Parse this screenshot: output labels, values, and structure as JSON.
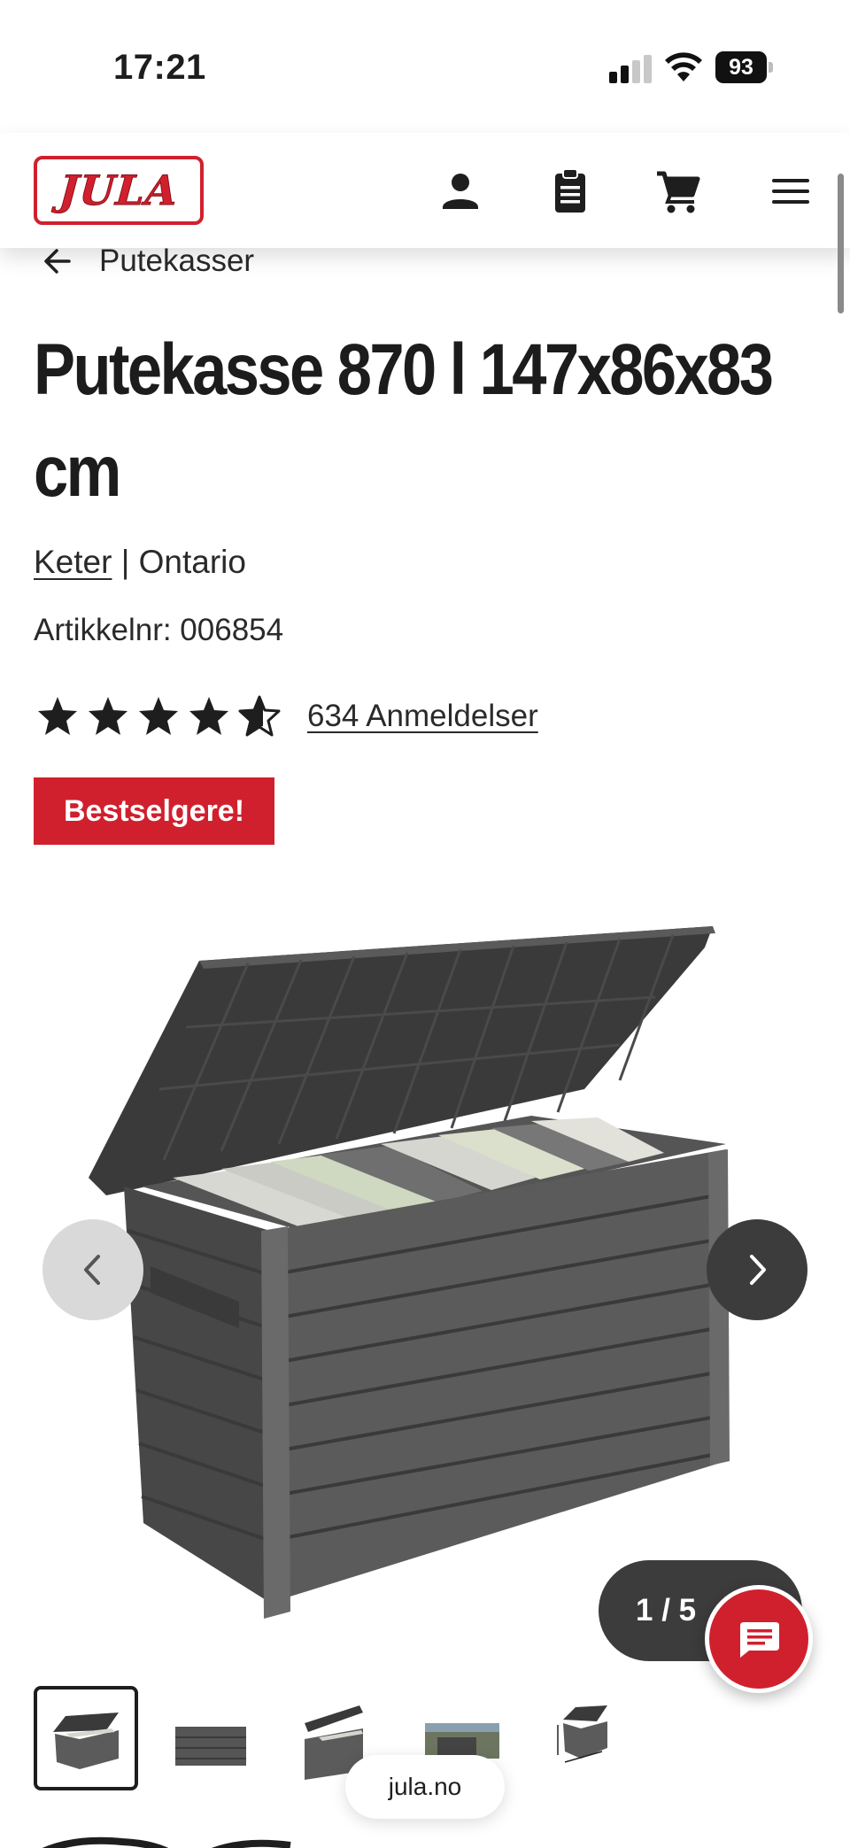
{
  "status_bar": {
    "time": "17:21",
    "battery": "93",
    "icons": [
      "cellular-signal-icon",
      "wifi-icon",
      "battery-icon"
    ]
  },
  "header": {
    "logo_text": "JULA",
    "icons": [
      "account-icon",
      "shopping-list-icon",
      "cart-icon",
      "menu-icon"
    ],
    "brand_color": "#d0202e"
  },
  "breadcrumb": {
    "label": "Putekasser"
  },
  "product": {
    "title": "Putekasse 870 l 147x86x83 cm",
    "brand": "Keter",
    "separator": "|",
    "series": "Ontario",
    "article_number": "Artikkelnr: 006854",
    "rating": 4.5,
    "rating_max": 5,
    "reviews": "634 Anmeldelser",
    "badge": "Bestselgere!"
  },
  "gallery": {
    "counter": "1 / 5",
    "current": 1,
    "total": 5,
    "thumbnails": [
      "storage-box-open",
      "storage-box-closed",
      "storage-box-lid",
      "storage-box-garden",
      "storage-box-dimensions"
    ]
  },
  "browser": {
    "url": "jula.no"
  }
}
